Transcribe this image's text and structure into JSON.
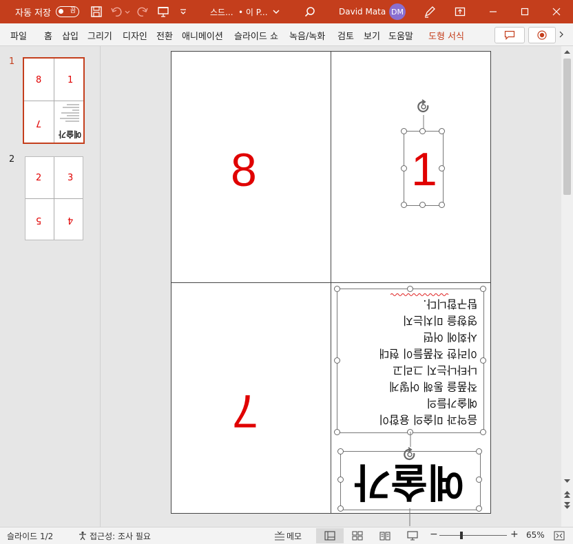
{
  "titlebar": {
    "autosave_label": "자동 저장",
    "autosave_state": "끔",
    "filename": "스드...",
    "location": "• 이 P...",
    "user_name": "David Mata",
    "user_initials": "DM"
  },
  "ribbon": {
    "tabs": [
      "파일",
      "홈",
      "삽입",
      "그리기",
      "디자인",
      "전환",
      "애니메이션",
      "슬라이드 쇼",
      "녹음/녹화",
      "검토",
      "보기",
      "도움말",
      "도형 서식"
    ]
  },
  "slides_panel": {
    "slides": [
      {
        "number": "1",
        "labels": [
          "8",
          "1",
          "7"
        ],
        "caption": "예술가"
      },
      {
        "number": "2",
        "labels": [
          "2",
          "3",
          "5",
          "4"
        ]
      }
    ]
  },
  "slide": {
    "q_top_left": "8",
    "q_top_right": "1",
    "q_bottom_left": "7",
    "body_lines": [
      "음악과 미술의 융합이",
      "예술가들의",
      "작품을 통해 어떻게",
      "나타나는지 그리고",
      "이러한 작품들이 현대",
      "사회에 어떤",
      "영향을 미치는지",
      "탐구합니다."
    ],
    "title": "예술가"
  },
  "statusbar": {
    "slide_info": "슬라이드 1/2",
    "accessibility": "접근성: 조사 필요",
    "notes_label": "메모",
    "zoom": "65%"
  },
  "colors": {
    "accent": "#c43e1c",
    "slide_number_red": "#e00000"
  }
}
